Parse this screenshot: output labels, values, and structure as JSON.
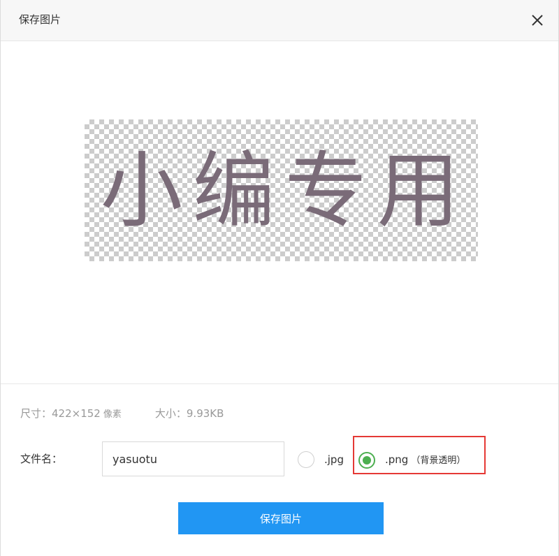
{
  "dialog": {
    "title": "保存图片",
    "close_icon": "close-icon"
  },
  "preview": {
    "text": "小编专用",
    "text_color": "#7a6b78",
    "background": "transparent-checkerboard"
  },
  "info": {
    "dimensions_label": "尺寸：",
    "dimensions_value": "422×152",
    "dimensions_unit": "像素",
    "size_label": "大小：",
    "size_value": "9.93KB"
  },
  "filename": {
    "label": "文件名：",
    "value": "yasuotu"
  },
  "formats": {
    "jpg_label": ".jpg",
    "png_label": ".png",
    "png_note": "（背景透明）",
    "selected": ".png"
  },
  "highlight": {
    "color": "#e53935"
  },
  "save_button": {
    "label": "保存图片",
    "color": "#2196f3"
  }
}
